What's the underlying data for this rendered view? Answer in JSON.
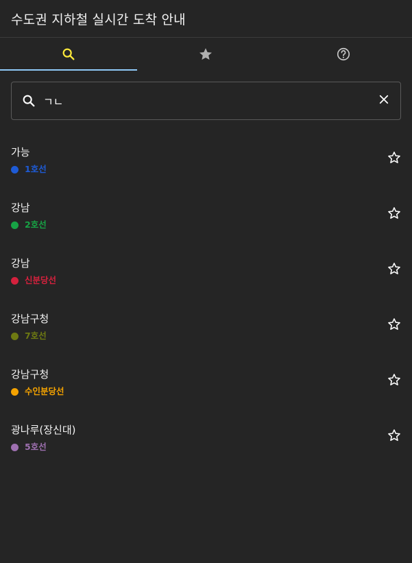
{
  "header": {
    "title": "수도권 지하철 실시간 도착 안내"
  },
  "tabs": [
    {
      "icon": "search-icon",
      "active": true,
      "color": "#ffeb3b"
    },
    {
      "icon": "star-icon",
      "active": false,
      "color": "#b0b0b0"
    },
    {
      "icon": "help-icon",
      "active": false,
      "color": "#c8c8c8"
    }
  ],
  "search": {
    "value": "ㄱㄴ",
    "placeholder": ""
  },
  "results": [
    {
      "station": "가능",
      "line": "1호선",
      "color": "#1e5bd6"
    },
    {
      "station": "강남",
      "line": "2호선",
      "color": "#17a345"
    },
    {
      "station": "강남",
      "line": "신분당선",
      "color": "#d4213d"
    },
    {
      "station": "강남구청",
      "line": "7호선",
      "color": "#6e7a12"
    },
    {
      "station": "강남구청",
      "line": "수인분당선",
      "color": "#f5a300"
    },
    {
      "station": "광나루(장신대)",
      "line": "5호선",
      "color": "#9e70b0"
    }
  ]
}
